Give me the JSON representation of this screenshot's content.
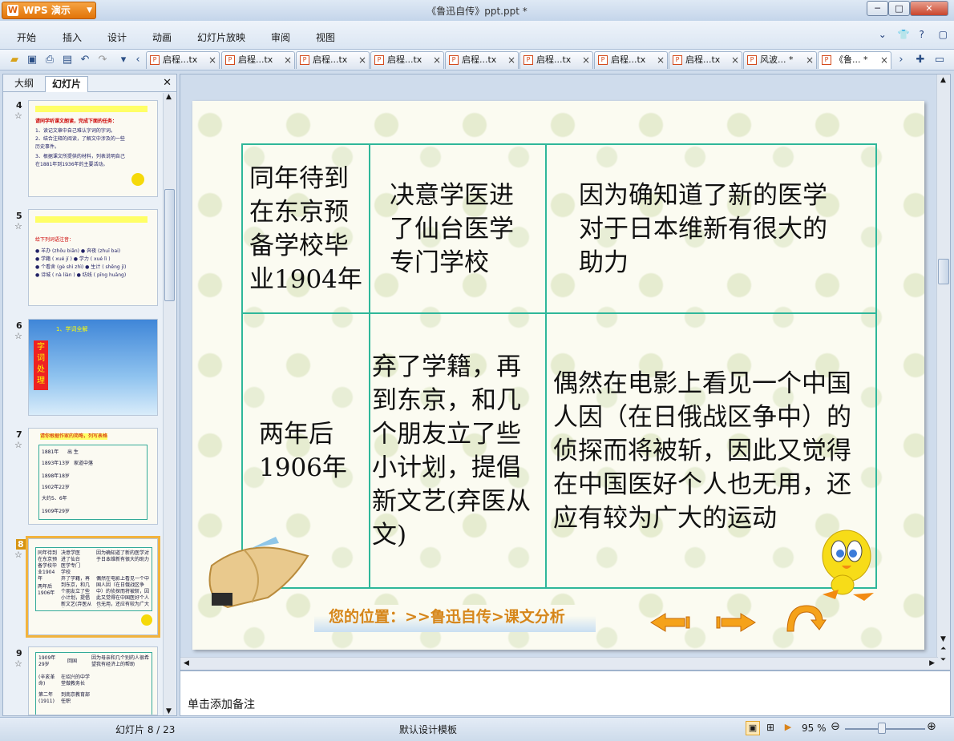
{
  "app": {
    "name": "WPS 演示",
    "doc_title": "《鲁迅自传》ppt.ppt *"
  },
  "menu": {
    "items": [
      "开始",
      "插入",
      "设计",
      "动画",
      "幻灯片放映",
      "审阅",
      "视图"
    ]
  },
  "tabs": [
    {
      "label": "启程...tx"
    },
    {
      "label": "启程...tx"
    },
    {
      "label": "启程...tx"
    },
    {
      "label": "启程...tx"
    },
    {
      "label": "启程...tx"
    },
    {
      "label": "启程...tx"
    },
    {
      "label": "启程...tx"
    },
    {
      "label": "启程...tx"
    },
    {
      "label": "风波... *"
    },
    {
      "label": "《鲁... *"
    }
  ],
  "panel": {
    "tabs": [
      "大纲",
      "幻灯片"
    ]
  },
  "thumbnails": [
    {
      "number": "4",
      "lines": [
        "请同学听课文朗读，完成下面的任务：",
        "1、读记文章中自己难认字词的字词。",
        "2、结合注释的阅读，了解文中涉及的一些",
        "   历史事件。",
        "3、根据课文所提供的材料，列表说明自己",
        "   在1881年到1936年的主要活动。"
      ]
    },
    {
      "number": "5",
      "lines": [
        "给下列词语注音：",
        "● 羊办 (zhōu biān)  ● 奔夜 (zhuī bai)",
        "● 学籍 ( xué jí )  ● 学力 ( xué lì )",
        "● 个看舍 (gè shì zhì) ● 生计 ( shēng jì)",
        "● 诗城 ( nà liàn )  ● 纺线 ( pīng huāng)"
      ]
    },
    {
      "number": "6",
      "lines": [
        "1、学词全解",
        "字词处理"
      ]
    },
    {
      "number": "7",
      "lines": [
        "请你根据作家的简略，列写表格",
        "1881年",
        "出 生",
        "1893年13岁",
        "家道中落",
        "1898年18岁",
        "1902年22岁",
        "大约5、6年",
        "1909年29岁"
      ]
    },
    {
      "number": "8",
      "lines": [
        "同年待到在东京预备学校毕业1904年",
        "决意学医进了仙台医学专门学校",
        "因为确知道了新的医学对于日本维新有很大的助力",
        "两年后1906年",
        "弃了学籍，再到东京，和几个朋友立了些小计划，提倡新文艺(弃医从文)",
        "偶然在电影上看见一个中国人因（在日俄战区争中）的侦探而将被斩，因此又觉得在中国医好个人也无用，还应有较为广大的运动"
      ]
    },
    {
      "number": "9",
      "lines": [
        "1909年29岁",
        "回国",
        "因为母亲和几个别的人很希望我有经济上的帮助",
        "(辛亥革命)",
        "在绍兴的中学堂做教务长",
        "第二年(1911)",
        "到南京教育部任职"
      ]
    }
  ],
  "slide": {
    "rows": [
      [
        "同年待到在东京预备学校毕业1904年",
        "决意学医进了仙台医学专门学校",
        "因为确知道了新的医学对于日本维新有很大的助力"
      ],
      [
        "两年后1906年",
        "弃了学籍，再到东京，和几个朋友立了些小计划，提倡新文艺(弃医从文)",
        "偶然在电影上看见一个中国人因（在日俄战区争中）的侦探而将被斩，因此又觉得在中国医好个人也无用，还应有较为广大的运动"
      ]
    ],
    "location": "您的位置：>>鲁迅自传>课文分析"
  },
  "notes": {
    "placeholder": "单击添加备注"
  },
  "status": {
    "slide_counter": "幻灯片 8 / 23",
    "template": "默认设计模板",
    "zoom": "95 %"
  },
  "colors": {
    "accent": "#e27408",
    "table_border": "#2fb79a",
    "location_text": "#d6861a"
  }
}
